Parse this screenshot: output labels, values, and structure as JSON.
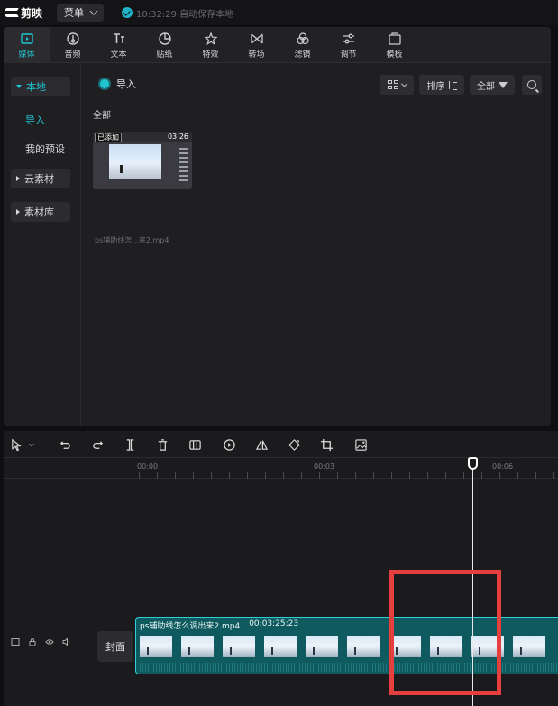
{
  "app": {
    "name": "剪映"
  },
  "titlebar": {
    "menu_label": "菜单",
    "save_status": "10:32:29 自动保存本地"
  },
  "tabs": [
    {
      "label": "媒体",
      "icon": "media-icon",
      "active": true
    },
    {
      "label": "音频",
      "icon": "audio-icon",
      "active": false
    },
    {
      "label": "文本",
      "icon": "text-icon",
      "active": false
    },
    {
      "label": "贴纸",
      "icon": "sticker-icon",
      "active": false
    },
    {
      "label": "特效",
      "icon": "effects-icon",
      "active": false
    },
    {
      "label": "转场",
      "icon": "transition-icon",
      "active": false
    },
    {
      "label": "滤镜",
      "icon": "filter-icon",
      "active": false
    },
    {
      "label": "调节",
      "icon": "adjust-icon",
      "active": false
    },
    {
      "label": "模板",
      "icon": "template-icon",
      "active": false
    }
  ],
  "sidebar": {
    "local": "本地",
    "import": "导入",
    "my_presets": "我的预设",
    "cloud": "云素材",
    "library": "素材库"
  },
  "content": {
    "import_label": "导入",
    "sort_label": "排序",
    "filter_label": "全部",
    "section_all": "全部",
    "media": {
      "badge": "已添加",
      "duration": "03:26",
      "filename": "ps辅助线怎...来2.mp4"
    }
  },
  "timeline": {
    "ruler": [
      "00:00",
      "00:03",
      "00:06"
    ],
    "cover_label": "封面",
    "clip": {
      "name": "ps辅助线怎么调出来2.mp4",
      "duration": "00:03:25:23"
    }
  },
  "colors": {
    "accent": "#20c4cf",
    "clip_bg": "#0e5a5f",
    "highlight": "#e53f3f"
  }
}
